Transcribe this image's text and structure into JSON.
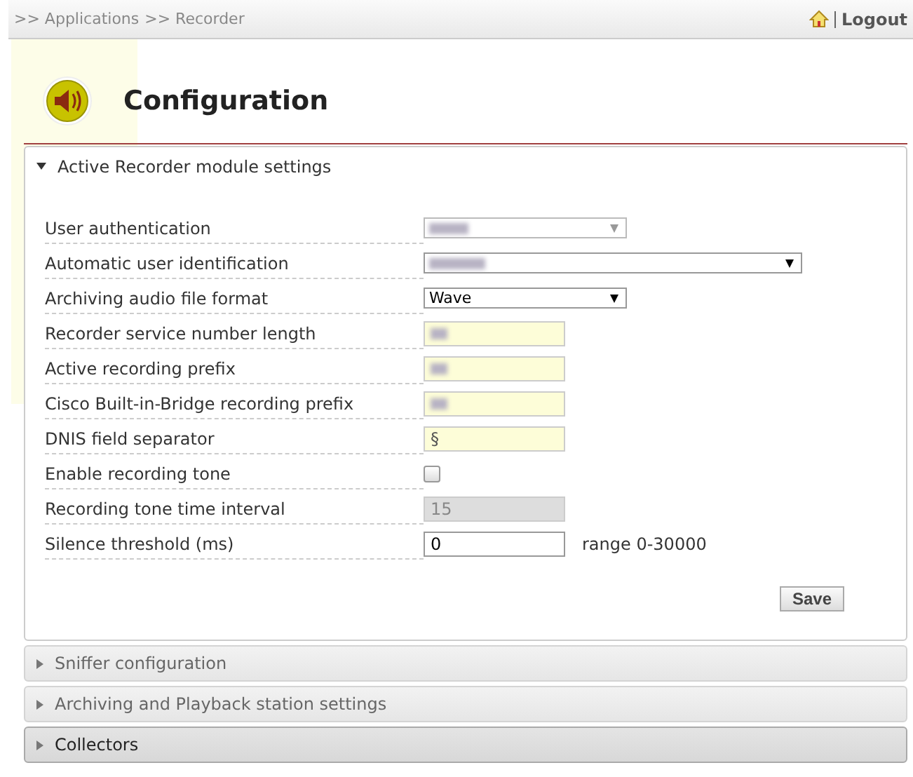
{
  "breadcrumb": [
    ">> Applications",
    ">> Recorder"
  ],
  "logout": "Logout",
  "page_title": "Configuration",
  "sections": [
    {
      "title": "Active Recorder module settings",
      "expanded": true,
      "focused": false,
      "fields": [
        {
          "label": "User authentication",
          "kind": "select",
          "redacted": true,
          "disabled": true,
          "wide": false
        },
        {
          "label": "Automatic user identification",
          "kind": "select",
          "redacted": true,
          "disabled": false,
          "wide": true
        },
        {
          "label": "Archiving audio file format",
          "kind": "select",
          "value": "Wave",
          "disabled": false,
          "wide": false
        },
        {
          "label": "Recorder service number length",
          "kind": "text",
          "redacted": true,
          "highlighted": true
        },
        {
          "label": "Active recording prefix",
          "kind": "text",
          "redacted": true,
          "highlighted": true
        },
        {
          "label": "Cisco Built-in-Bridge recording prefix",
          "kind": "text",
          "redacted": true,
          "highlighted": true
        },
        {
          "label": "DNIS field separator",
          "kind": "text",
          "value": "§",
          "highlighted": true
        },
        {
          "label": "Enable recording tone",
          "kind": "checkbox",
          "checked": false
        },
        {
          "label": "Recording tone time interval",
          "kind": "text",
          "value": "15",
          "disabled": true
        },
        {
          "label": "Silence threshold (ms)",
          "kind": "text",
          "value": "0",
          "note": "range 0-30000"
        }
      ],
      "save": "Save"
    },
    {
      "title": "Sniffer configuration",
      "expanded": false,
      "focused": false
    },
    {
      "title": "Archiving and Playback station settings",
      "expanded": false,
      "focused": false
    },
    {
      "title": "Collectors",
      "expanded": false,
      "focused": true
    }
  ]
}
